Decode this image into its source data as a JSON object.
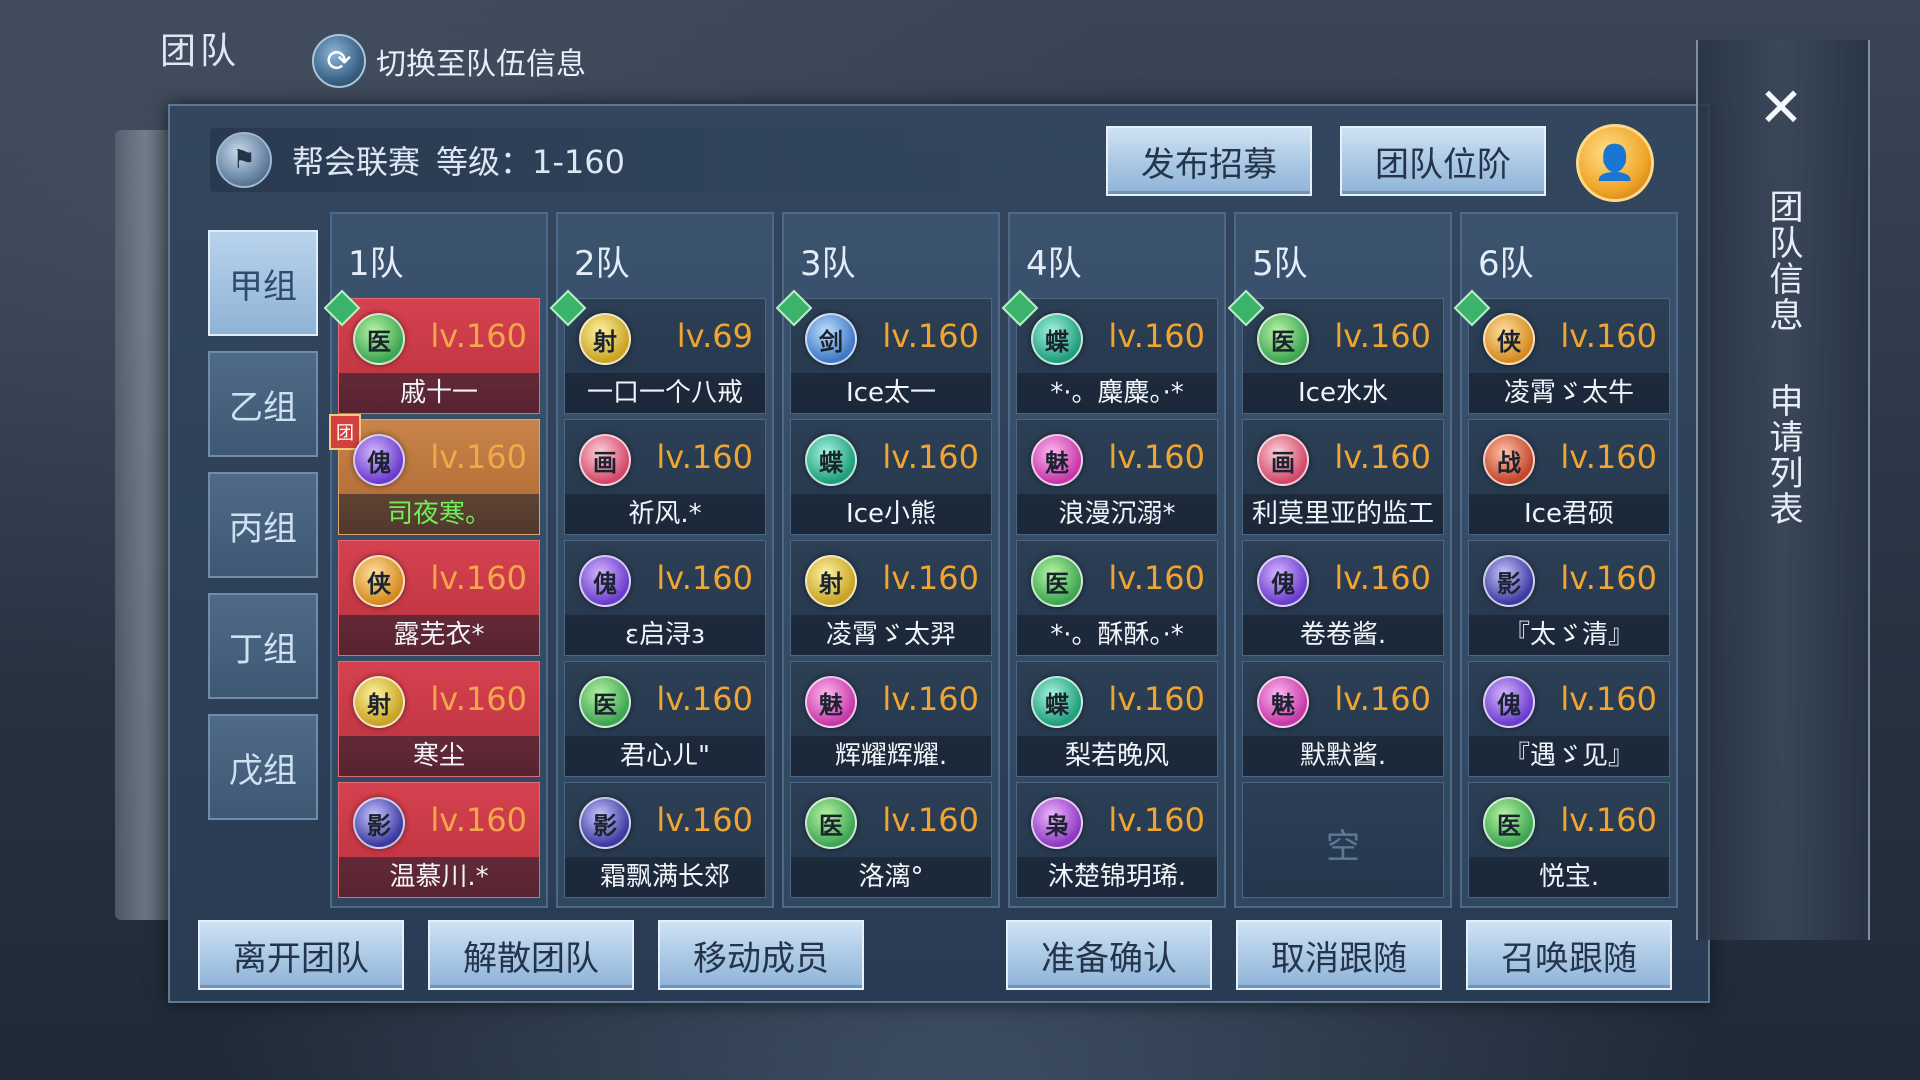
{
  "top": {
    "title": "团队",
    "switch_label": "切换至队伍信息"
  },
  "header": {
    "event": "帮会联赛",
    "level": "等级：1-160"
  },
  "buttons": {
    "recruit": "发布招募",
    "rank": "团队位阶"
  },
  "groups": [
    "甲组",
    "乙组",
    "丙组",
    "丁组",
    "戊组"
  ],
  "teams": [
    {
      "name": "1队",
      "members": [
        {
          "cls": "医",
          "lv": "lv.160",
          "name": "戚十一",
          "style": "red",
          "leader": true
        },
        {
          "cls": "傀",
          "lv": "lv.160",
          "name": "司夜寒。",
          "style": "orange",
          "team_mark": "团"
        },
        {
          "cls": "侠",
          "lv": "lv.160",
          "name": "露芜衣*",
          "style": "red"
        },
        {
          "cls": "射",
          "lv": "lv.160",
          "name": "寒尘",
          "style": "red"
        },
        {
          "cls": "影",
          "lv": "lv.160",
          "name": "温慕川.*",
          "style": "red"
        }
      ]
    },
    {
      "name": "2队",
      "members": [
        {
          "cls": "射",
          "lv": "lv.69",
          "name": "一口一个八戒",
          "leader": true
        },
        {
          "cls": "画",
          "lv": "lv.160",
          "name": "祈风.*"
        },
        {
          "cls": "傀",
          "lv": "lv.160",
          "name": "ε启浔з"
        },
        {
          "cls": "医",
          "lv": "lv.160",
          "name": "君心ㄦ\""
        },
        {
          "cls": "影",
          "lv": "lv.160",
          "name": "霜飘满长郊"
        }
      ]
    },
    {
      "name": "3队",
      "members": [
        {
          "cls": "剑",
          "lv": "lv.160",
          "name": "Ice太一",
          "leader": true
        },
        {
          "cls": "蝶",
          "lv": "lv.160",
          "name": "Ice小熊"
        },
        {
          "cls": "射",
          "lv": "lv.160",
          "name": "凌霄ゞ太羿"
        },
        {
          "cls": "魅",
          "lv": "lv.160",
          "name": "辉耀辉耀."
        },
        {
          "cls": "医",
          "lv": "lv.160",
          "name": "洛漓°"
        }
      ]
    },
    {
      "name": "4队",
      "members": [
        {
          "cls": "蝶",
          "lv": "lv.160",
          "name": "*·。麋麋。·*",
          "leader": true
        },
        {
          "cls": "魅",
          "lv": "lv.160",
          "name": "浪漫沉溺*"
        },
        {
          "cls": "医",
          "lv": "lv.160",
          "name": "*·。酥酥。·*"
        },
        {
          "cls": "蝶",
          "lv": "lv.160",
          "name": "梨若晚风"
        },
        {
          "cls": "枭",
          "lv": "lv.160",
          "name": "沐楚锦玥琋."
        }
      ]
    },
    {
      "name": "5队",
      "members": [
        {
          "cls": "医",
          "lv": "lv.160",
          "name": "Ice水水",
          "leader": true
        },
        {
          "cls": "画",
          "lv": "lv.160",
          "name": "利莫里亚的监工"
        },
        {
          "cls": "傀",
          "lv": "lv.160",
          "name": "卷卷酱."
        },
        {
          "cls": "魅",
          "lv": "lv.160",
          "name": "默默酱."
        },
        {
          "empty": "空"
        }
      ]
    },
    {
      "name": "6队",
      "members": [
        {
          "cls": "侠",
          "lv": "lv.160",
          "name": "凌霄ゞ太牛",
          "leader": true
        },
        {
          "cls": "战",
          "lv": "lv.160",
          "name": "Ice君硕"
        },
        {
          "cls": "影",
          "lv": "lv.160",
          "name": "『太ゞ清』"
        },
        {
          "cls": "傀",
          "lv": "lv.160",
          "name": "『遇ゞ见』"
        },
        {
          "cls": "医",
          "lv": "lv.160",
          "name": "悦宝."
        }
      ]
    }
  ],
  "bottom": {
    "leave": "离开团队",
    "disband": "解散团队",
    "move": "移动成员",
    "ready": "准备确认",
    "unfollow": "取消跟随",
    "summon": "召唤跟随"
  },
  "side": {
    "team_info": "团队信息",
    "applications": "申请列表",
    "close": "✕"
  },
  "colors": {
    "accent_red": "#d6414f",
    "accent_orange": "#c8844a",
    "level_orange": "#f1a531"
  }
}
